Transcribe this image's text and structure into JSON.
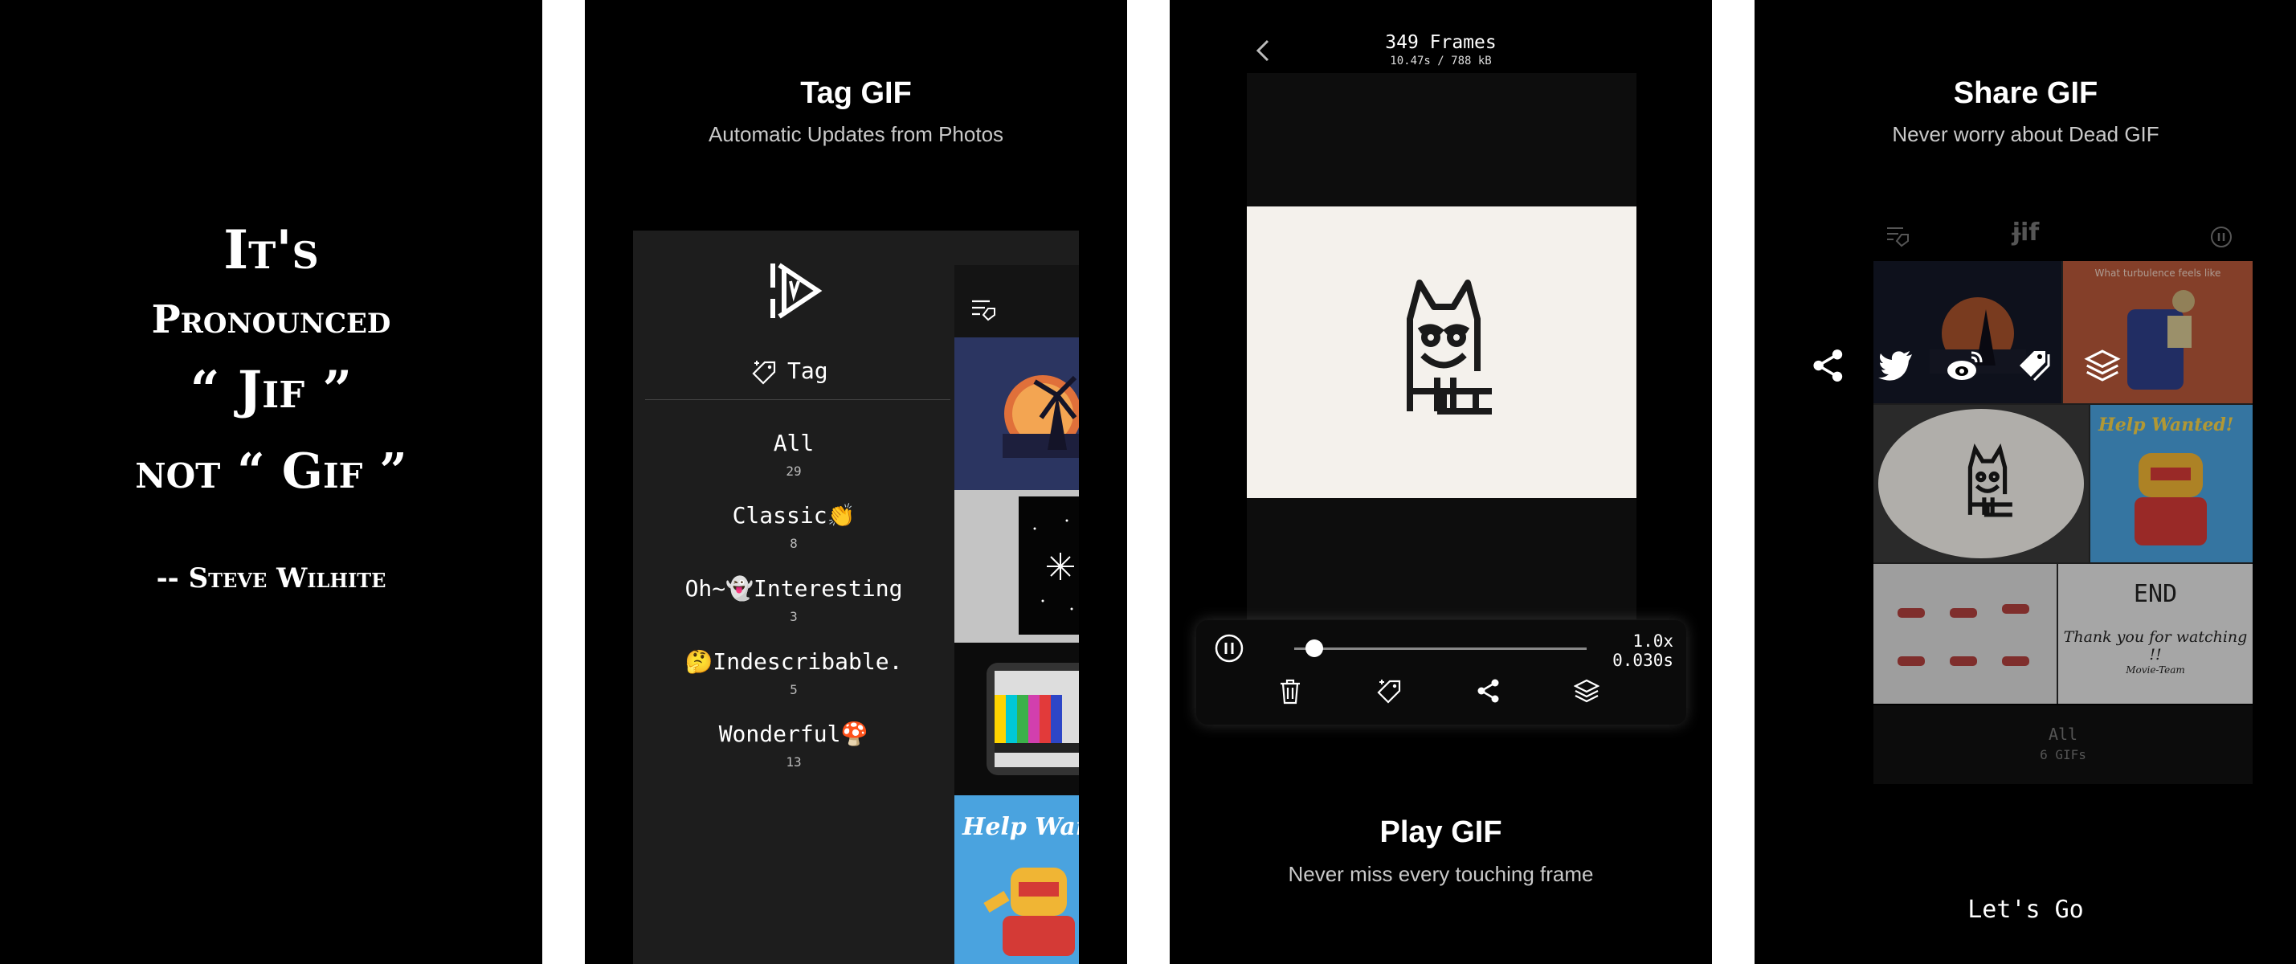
{
  "panel1": {
    "quote_line1": "It's",
    "quote_line2": "Pronounced",
    "quote_line3": "“ Jif ”",
    "quote_line4": "not “ Gif ”",
    "quote_author": "-- Steve Wilhite"
  },
  "panel2": {
    "title": "Tag GIF",
    "subtitle": "Automatic Updates from Photos",
    "tag_header": "Tag",
    "tags": [
      {
        "label": "All",
        "count": "29"
      },
      {
        "label": "Classic👏",
        "count": "8"
      },
      {
        "label": "Oh~👻Interesting",
        "count": "3"
      },
      {
        "label": "🤔Indescribable.",
        "count": "5"
      },
      {
        "label": "Wonderful🍄",
        "count": "13"
      }
    ],
    "thumb_help_text": "Help Wan"
  },
  "panel3": {
    "frames": "349 Frames",
    "meta": "10.47s / 788 kB",
    "speed": "1.0x",
    "frame_time": "0.030s",
    "progress": 0.07,
    "title": "Play GIF",
    "subtitle": "Never miss every touching frame"
  },
  "panel4": {
    "title": "Share GIF",
    "subtitle": "Never worry about Dead GIF",
    "logo": "ɉif",
    "thumb_text_turbulence": "What turbulence feels like",
    "thumb_text_help": "Help Wanted!",
    "thumb_text_end": "END",
    "thumb_text_thanks": "Thank you for watching !!",
    "thumb_text_sign": "Movie-Team",
    "footer_all": "All",
    "footer_count": "6 GIFs",
    "cta": "Let's Go"
  },
  "colors": {
    "background": "#000000",
    "panel_gray": "#1d1d1d",
    "accent_orange": "#e0703a"
  }
}
